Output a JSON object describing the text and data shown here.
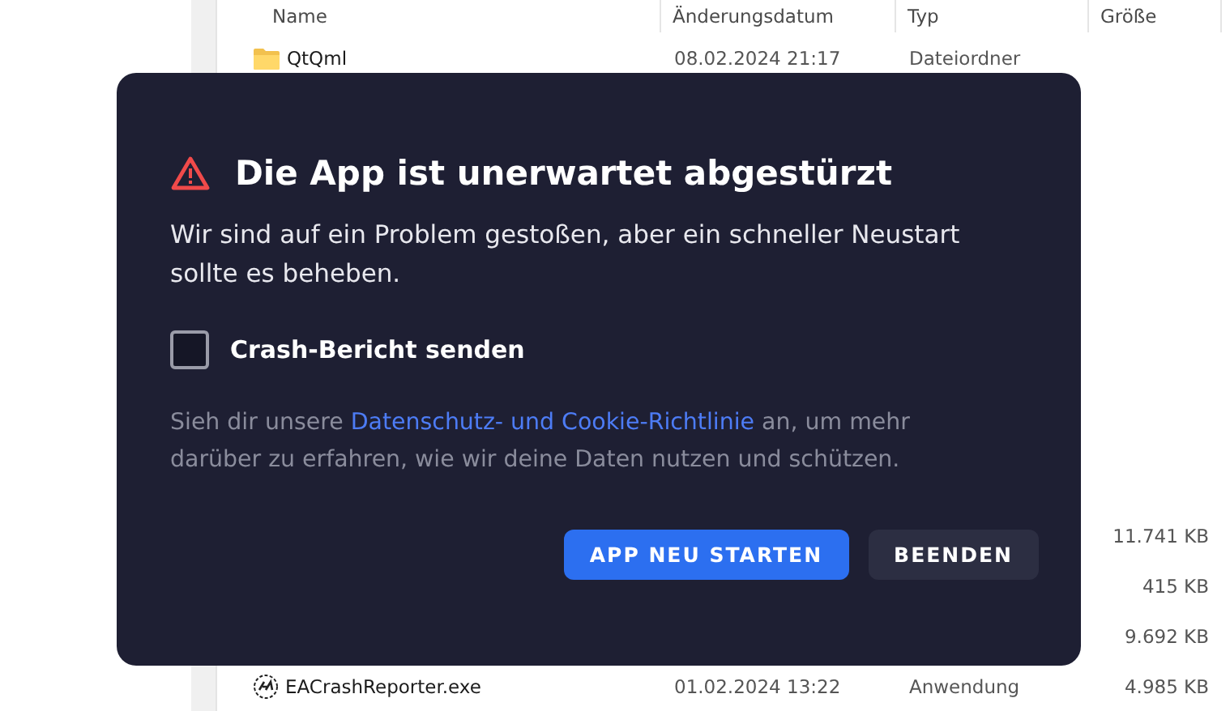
{
  "explorer": {
    "columns": [
      "Name",
      "Änderungsdatum",
      "Typ",
      "Größe"
    ],
    "top_rows": [
      {
        "kind": "folder",
        "name": "QtQml",
        "date": "08.02.2024 21:17",
        "type": "Dateiordner"
      }
    ],
    "bottom_rows": [
      {
        "size": "11.741 KB"
      },
      {
        "size": "415 KB"
      },
      {
        "size": "9.692 KB"
      },
      {
        "kind": "app",
        "name": "EACrashReporter.exe",
        "date": "01.02.2024 13:22",
        "type": "Anwendung",
        "size": "4.985 KB"
      }
    ]
  },
  "dialog": {
    "title": "Die App ist unerwartet abgestürzt",
    "message": "Wir sind auf ein Problem gestoßen, aber ein schneller Neustart sollte es beheben.",
    "checkbox": {
      "label": "Crash-Bericht senden",
      "checked": false
    },
    "privacy": {
      "before": "Sieh dir unsere ",
      "link": "Datenschutz- und Cookie-Richtlinie",
      "after": " an, um mehr darüber zu erfahren, wie wir deine Daten nutzen und schützen."
    },
    "buttons": [
      {
        "label": "APP NEU STARTEN",
        "kind": "primary"
      },
      {
        "label": "BEENDEN",
        "kind": "secondary"
      }
    ]
  }
}
